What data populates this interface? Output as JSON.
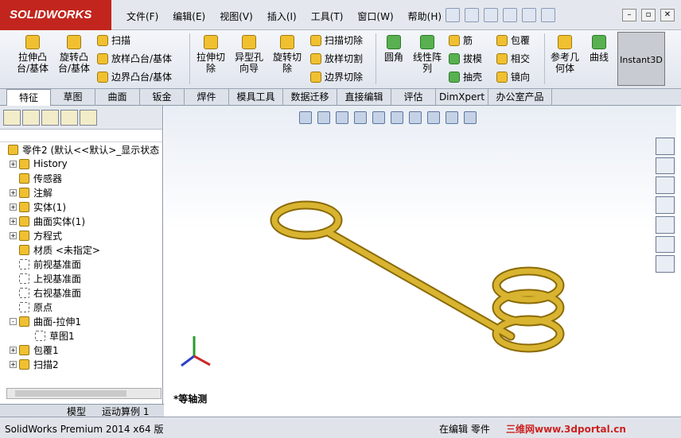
{
  "app": {
    "brand": "SOLIDWORKS"
  },
  "menu": [
    "文件(F)",
    "编辑(E)",
    "视图(V)",
    "插入(I)",
    "工具(T)",
    "窗口(W)",
    "帮助(H)"
  ],
  "ribbon": {
    "extrude_boss": "拉伸凸台/基体",
    "revolve_boss": "旋转凸台/基体",
    "sweep": "扫描",
    "loft": "放样凸台/基体",
    "boundary": "边界凸台/基体",
    "extrude_cut": "拉伸切除",
    "hole_wizard": "异型孔向导",
    "revolve_cut": "旋转切除",
    "swept_cut": "扫描切除",
    "lofted_cut": "放样切割",
    "boundary_cut": "边界切除",
    "fillet": "圆角",
    "linear_pattern": "线性阵列",
    "rib": "筋",
    "draft": "拔模",
    "shell": "抽壳",
    "wrap": "包覆",
    "intersect": "相交",
    "mirror": "镜向",
    "ref_geometry": "参考几何体",
    "curves": "曲线",
    "instant3d": "Instant3D"
  },
  "tabs": [
    "特征",
    "草图",
    "曲面",
    "钣金",
    "焊件",
    "模具工具",
    "数据迁移",
    "直接编辑",
    "评估",
    "DimXpert",
    "办公室产品"
  ],
  "tree": {
    "root": "零件2 (默认<<默认>_显示状态",
    "items": [
      {
        "label": "History",
        "exp": "+"
      },
      {
        "label": "传感器",
        "exp": ""
      },
      {
        "label": "注解",
        "exp": "+"
      },
      {
        "label": "实体(1)",
        "exp": "+"
      },
      {
        "label": "曲面实体(1)",
        "exp": "+"
      },
      {
        "label": "方程式",
        "exp": "+"
      },
      {
        "label": "材质 <未指定>",
        "exp": ""
      },
      {
        "label": "前视基准面",
        "exp": ""
      },
      {
        "label": "上视基准面",
        "exp": ""
      },
      {
        "label": "右视基准面",
        "exp": ""
      },
      {
        "label": "原点",
        "exp": ""
      },
      {
        "label": "曲面-拉伸1",
        "exp": "-"
      },
      {
        "label": "草图1",
        "exp": "",
        "child": true
      },
      {
        "label": "包覆1",
        "exp": "+"
      },
      {
        "label": "扫描2",
        "exp": "+"
      }
    ]
  },
  "bottom_tabs": {
    "model": "模型",
    "motion": "运动算例 1"
  },
  "viewport": {
    "view_label": "*等轴测"
  },
  "status": {
    "product": "SolidWorks Premium 2014 x64 版",
    "editing": "在编辑 零件",
    "watermark": "三维网www.3dportal.cn"
  }
}
